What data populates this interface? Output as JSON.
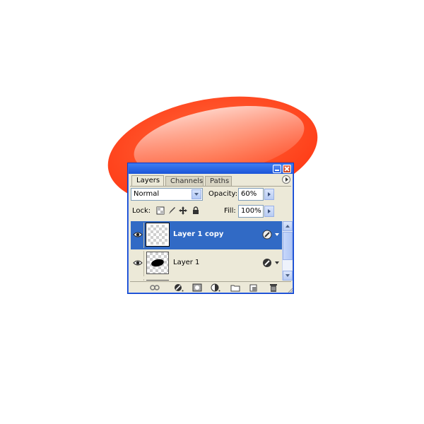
{
  "colors": {
    "accent_selected": "#316ac5",
    "titlebar": "#1c55d8",
    "panel_bg": "#ece9d8",
    "ellipse": "#ff4a22"
  },
  "tabs": [
    {
      "label": "Layers",
      "active": true
    },
    {
      "label": "Channels",
      "active": false
    },
    {
      "label": "Paths",
      "active": false
    }
  ],
  "blend_mode": {
    "value": "Normal"
  },
  "opacity": {
    "label": "Opacity:",
    "value": "60%"
  },
  "lock": {
    "label": "Lock:",
    "icons": [
      "lock-transparent-icon",
      "lock-image-icon",
      "lock-position-icon",
      "lock-all-icon"
    ]
  },
  "fill": {
    "label": "Fill:",
    "value": "100%"
  },
  "layers": [
    {
      "name": "Layer 1 copy",
      "selected": true,
      "visible": true
    },
    {
      "name": "Layer 1",
      "selected": false,
      "visible": true
    }
  ],
  "footer_icons": [
    "link-layers-icon",
    "layer-style-icon",
    "layer-mask-icon",
    "adjustment-layer-icon",
    "new-group-icon",
    "new-layer-icon",
    "trash-icon"
  ]
}
